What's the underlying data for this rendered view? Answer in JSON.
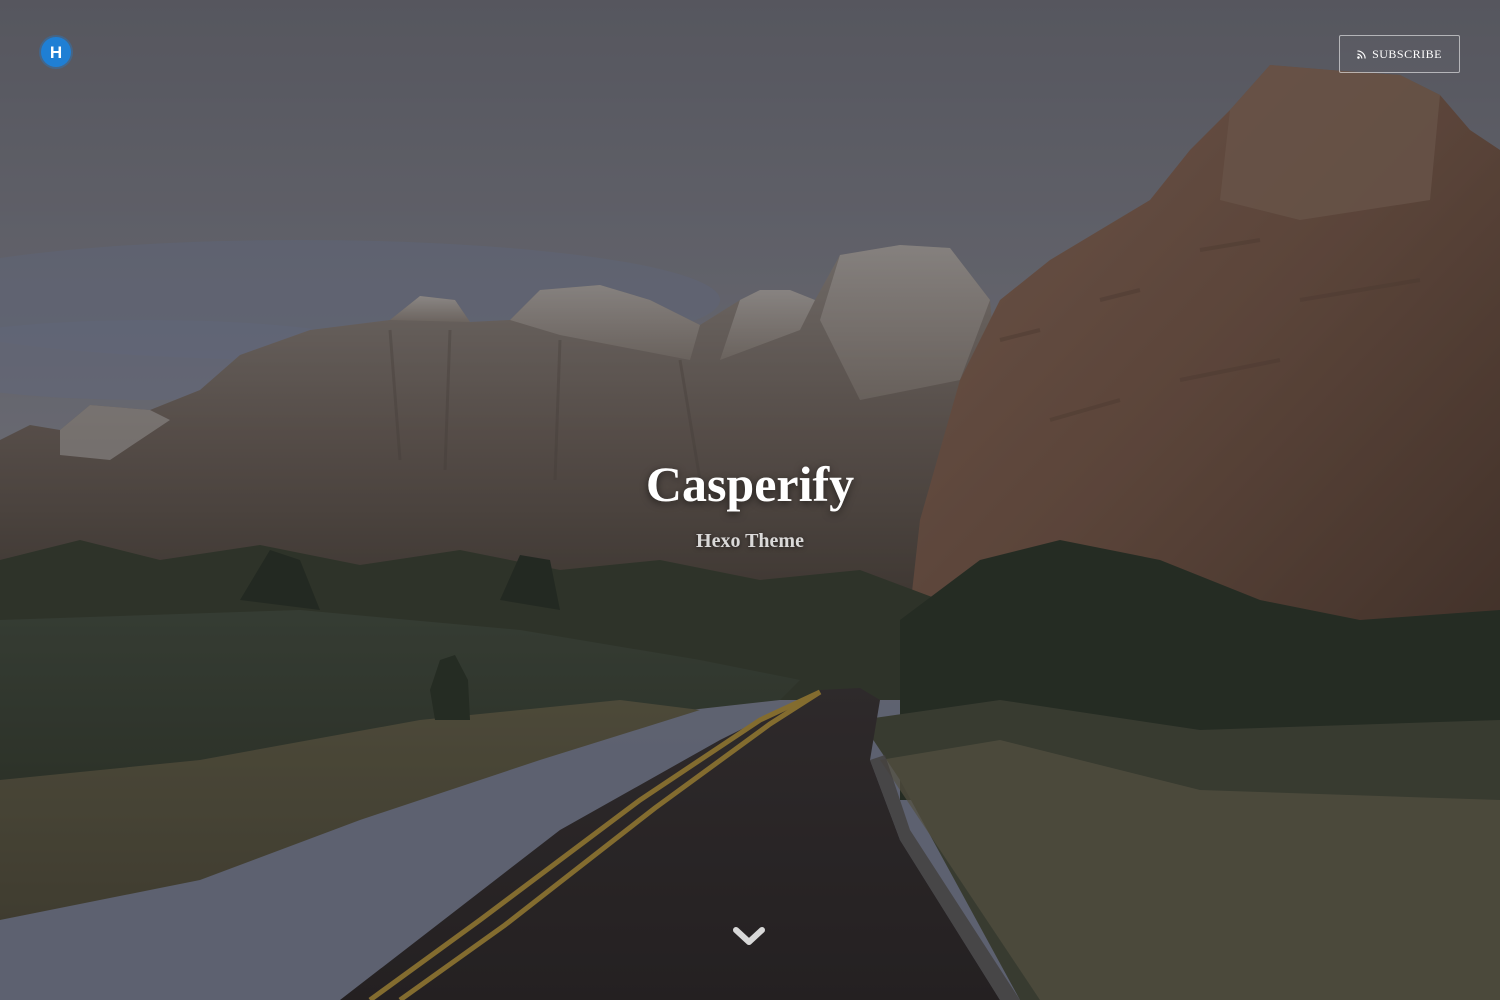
{
  "header": {
    "logo": {
      "letter": "H",
      "icon": "hexo-logo-icon",
      "color": "#1f7fd4"
    },
    "subscribe": {
      "label": "SUBSCRIBE",
      "icon": "rss-icon"
    }
  },
  "hero": {
    "title": "Casperify",
    "description": "Hexo Theme",
    "scroll_icon": "chevron-down-icon"
  }
}
